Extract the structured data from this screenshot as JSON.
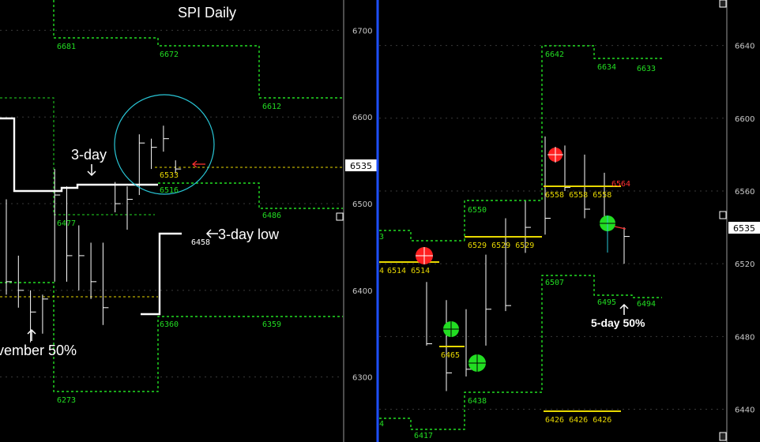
{
  "colors": {
    "background": "#000000",
    "grid": "#3a3a3a",
    "axis_text": "#c8c8c8",
    "price_bar": "#ffffff",
    "level_green": "#22dd22",
    "level_yellow": "#e8d800",
    "level_red": "#ff3030",
    "annotation": "#ffffff",
    "circle": "#29c6d6",
    "divider": "#1e4fff",
    "marker_green": "#22dd22",
    "marker_red": "#ff2020"
  },
  "chart_data": [
    {
      "type": "bar",
      "title": "SPI Daily",
      "y_ticks": [
        6300,
        6400,
        6500,
        6600,
        6700
      ],
      "ylim": [
        6225,
        6735
      ],
      "current_price": "6535",
      "bars": [
        {
          "x": 0,
          "h": 6505,
          "l": 6395,
          "c": 6410
        },
        {
          "x": 1,
          "h": 6440,
          "l": 6380,
          "c": 6400
        },
        {
          "x": 2,
          "h": 6400,
          "l": 6340,
          "c": 6375
        },
        {
          "x": 3,
          "h": 6395,
          "l": 6350,
          "c": 6390
        },
        {
          "x": 4,
          "h": 6540,
          "l": 6410,
          "c": 6510
        },
        {
          "x": 5,
          "h": 6520,
          "l": 6410,
          "c": 6440
        },
        {
          "x": 6,
          "h": 6475,
          "l": 6400,
          "c": 6440
        },
        {
          "x": 7,
          "h": 6455,
          "l": 6390,
          "c": 6410
        },
        {
          "x": 8,
          "h": 6455,
          "l": 6360,
          "c": 6380
        },
        {
          "x": 9,
          "h": 6525,
          "l": 6490,
          "c": 6500
        },
        {
          "x": 10,
          "h": 6520,
          "l": 6470,
          "c": 6505
        },
        {
          "x": 11,
          "h": 6580,
          "l": 6510,
          "c": 6570
        },
        {
          "x": 12,
          "h": 6575,
          "l": 6540,
          "c": 6565
        },
        {
          "x": 13,
          "h": 6590,
          "l": 6560,
          "c": 6575
        },
        {
          "x": 14,
          "h": 6550,
          "l": 6535,
          "c": 6540
        }
      ],
      "green_labels": [
        "6681",
        "6672",
        "6612",
        "6516",
        "6486",
        "6477",
        "6360",
        "6359",
        "6273"
      ],
      "yellow_labels": [
        "6533"
      ],
      "white_labels": [
        "6458"
      ],
      "annotations": {
        "three_day": "3-day",
        "three_day_low": "3-day low",
        "november": "vember 50%"
      }
    },
    {
      "type": "bar",
      "y_ticks": [
        6440,
        6480,
        6520,
        6560,
        6600,
        6640
      ],
      "ylim": [
        6422,
        6665
      ],
      "current_price": "6535",
      "bars": [
        {
          "x": 0,
          "h": 6510,
          "l": 6475,
          "c": 6476
        },
        {
          "x": 1,
          "h": 6500,
          "l": 6450,
          "c": 6460
        },
        {
          "x": 2,
          "h": 6495,
          "l": 6458,
          "c": 6462
        },
        {
          "x": 3,
          "h": 6525,
          "l": 6475,
          "c": 6495
        },
        {
          "x": 4,
          "h": 6545,
          "l": 6494,
          "c": 6497
        },
        {
          "x": 5,
          "h": 6555,
          "l": 6526,
          "c": 6540
        },
        {
          "x": 6,
          "h": 6590,
          "l": 6536,
          "c": 6545
        },
        {
          "x": 7,
          "h": 6585,
          "l": 6560,
          "c": 6562
        },
        {
          "x": 8,
          "h": 6580,
          "l": 6545,
          "c": 6550
        },
        {
          "x": 9,
          "h": 6570,
          "l": 6540,
          "c": 6545
        },
        {
          "x": 10,
          "h": 6540,
          "l": 6520,
          "c": 6535
        }
      ],
      "green_labels": [
        "6642",
        "6634",
        "6633",
        "6550",
        "6507",
        "6495",
        "6494",
        "6438",
        "6417"
      ],
      "yellow_labels": [
        "6514 6514",
        "6529 6529 6529",
        "6558 6558 6558",
        "6465",
        "6426 6426 6426"
      ],
      "red_labels": [
        "6564"
      ],
      "annotations": {
        "five_day": "5-day 50%"
      }
    }
  ]
}
